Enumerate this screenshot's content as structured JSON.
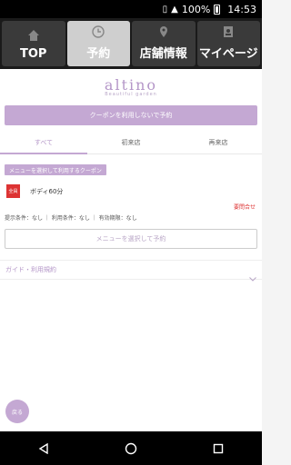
{
  "status_bar": {
    "battery_text": "100%",
    "time": "14:53"
  },
  "nav": {
    "tabs": [
      {
        "label": "TOP",
        "icon": "home-icon"
      },
      {
        "label": "予約",
        "icon": "clock-icon",
        "active": true
      },
      {
        "label": "店舗情報",
        "icon": "location-pin-icon"
      },
      {
        "label": "マイページ",
        "icon": "id-card-icon"
      }
    ]
  },
  "logo": {
    "brand": "altino",
    "tagline": "Beautiful garden"
  },
  "reserve_without_coupon": "クーポンを利用しないで予約",
  "filter_tabs": [
    "すべて",
    "初来店",
    "再来店"
  ],
  "section_chip": "メニューを選択して利用するクーポン",
  "coupon": {
    "badge": "全員",
    "name": "ボディ60分",
    "price": "要問合せ",
    "conditions": "提示条件：なし ｜ 利用条件：なし ｜ 有効期限：なし"
  },
  "select_menu_button": "メニューを選択して予約",
  "guide_label": "ガイド・利用規約",
  "back_button": "戻る",
  "colors": {
    "accent": "#c4a8d3",
    "alert": "#dd3333",
    "navbar": "#1a1a1a"
  }
}
